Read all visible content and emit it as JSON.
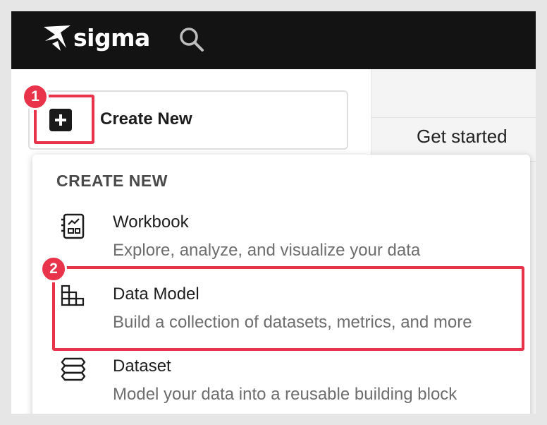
{
  "topbar": {
    "brand": "sigma",
    "search_icon": "search-icon"
  },
  "sidebar": {
    "create_button_label": "Create New",
    "create_button_icon": "plus-square-icon"
  },
  "right_panel": {
    "title": "Get started"
  },
  "create_menu": {
    "heading": "CREATE NEW",
    "items": [
      {
        "icon": "workbook-icon",
        "title": "Workbook",
        "description": "Explore, analyze, and visualize your data"
      },
      {
        "icon": "data-model-icon",
        "title": "Data Model",
        "description": "Build a collection of datasets, metrics, and more"
      },
      {
        "icon": "dataset-icon",
        "title": "Dataset",
        "description": "Model your data into a reusable building block"
      }
    ]
  },
  "annotations": {
    "step_1": "1",
    "step_2": "2",
    "highlight_color": "#e8334a"
  },
  "colors": {
    "topbar_bg": "#131313",
    "page_bg": "#ffffff",
    "panel_bg": "#f4f4f4"
  }
}
